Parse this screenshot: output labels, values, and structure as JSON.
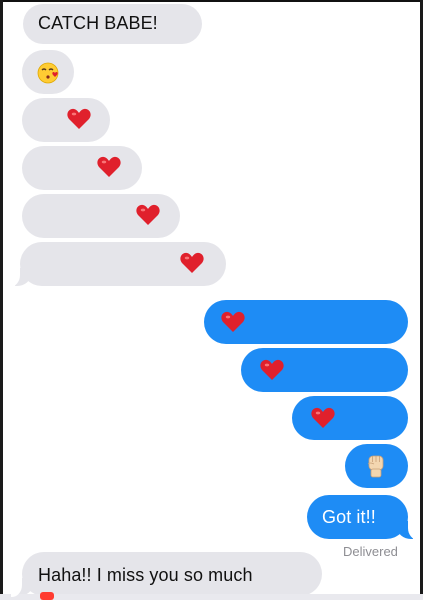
{
  "messages": [
    {
      "side": "received",
      "kind": "text",
      "text": "CATCH BABE!"
    },
    {
      "side": "received",
      "kind": "emoji",
      "icon": "kissing-face-emoji"
    },
    {
      "side": "received",
      "kind": "emoji",
      "icon": "red-heart-emoji"
    },
    {
      "side": "received",
      "kind": "emoji",
      "icon": "red-heart-emoji"
    },
    {
      "side": "received",
      "kind": "emoji",
      "icon": "red-heart-emoji"
    },
    {
      "side": "received",
      "kind": "emoji",
      "icon": "red-heart-emoji"
    },
    {
      "side": "sent",
      "kind": "emoji",
      "icon": "red-heart-emoji"
    },
    {
      "side": "sent",
      "kind": "emoji",
      "icon": "red-heart-emoji"
    },
    {
      "side": "sent",
      "kind": "emoji",
      "icon": "red-heart-emoji"
    },
    {
      "side": "sent",
      "kind": "emoji",
      "icon": "raised-fist-emoji"
    },
    {
      "side": "sent",
      "kind": "text",
      "text": "Got it!!"
    },
    {
      "side": "received",
      "kind": "text",
      "text": "Haha!! I miss you so much"
    }
  ],
  "status": {
    "delivered_label": "Delivered"
  },
  "colors": {
    "sent_bubble": "#1e8cf5",
    "received_bubble": "#e5e5ea",
    "heart": "#e0202c",
    "status_text": "#8e8e93"
  }
}
